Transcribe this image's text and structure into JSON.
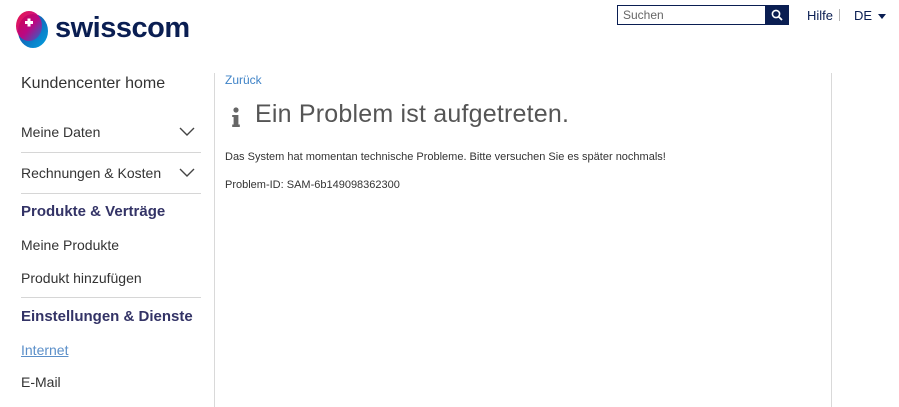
{
  "brand": {
    "name": "swisscom",
    "color": "#0a1e52",
    "icon": "swisscom-lifeform-logo"
  },
  "header": {
    "search": {
      "placeholder": "Suchen",
      "value": "",
      "icon": "search-icon"
    },
    "help_label": "Hilfe",
    "language": "DE",
    "language_icon": "caret-down-icon"
  },
  "sidebar": {
    "home": "Kundencenter home",
    "collapsible": [
      {
        "label": "Meine Daten",
        "icon": "chevron-down-icon"
      },
      {
        "label": "Rechnungen & Kosten",
        "icon": "chevron-down-icon"
      }
    ],
    "sections": [
      {
        "heading": "Produkte & Verträge",
        "links": [
          "Meine Produkte",
          "Produkt hinzufügen"
        ]
      },
      {
        "heading": "Einstellungen & Dienste",
        "links": [
          "Internet",
          "E-Mail"
        ]
      }
    ],
    "active_link": "Internet",
    "heading_color": "#333366",
    "active_color": "#5b8fc9"
  },
  "main": {
    "back_label": "Zurück",
    "icon": "info-icon",
    "title": "Ein Problem ist aufgetreten.",
    "message": "Das System hat momentan technische Probleme. Bitte versuchen Sie es später nochmals!",
    "problem_id": "Problem-ID: SAM-6b149098362300",
    "link_color": "#3f83c7"
  }
}
